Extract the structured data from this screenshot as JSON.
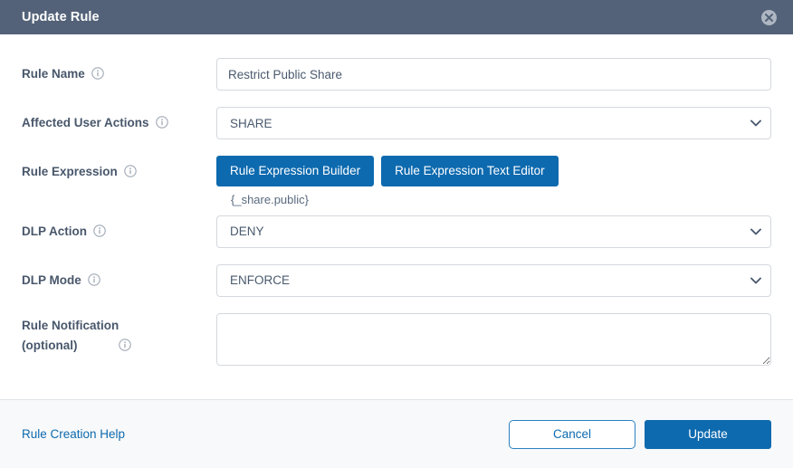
{
  "header": {
    "title": "Update Rule",
    "close_icon": "close-circle-icon"
  },
  "form": {
    "info_icon": "info-circle-icon",
    "rule_name": {
      "label": "Rule Name",
      "value": "Restrict Public Share",
      "placeholder": ""
    },
    "affected_user_actions": {
      "label": "Affected User Actions",
      "value": "SHARE",
      "chevron_icon": "chevron-down-icon"
    },
    "rule_expression": {
      "label": "Rule Expression",
      "builder_button": "Rule Expression Builder",
      "text_editor_button": "Rule Expression Text Editor",
      "expression": "{_share.public}"
    },
    "dlp_action": {
      "label": "DLP Action",
      "value": "DENY",
      "chevron_icon": "chevron-down-icon"
    },
    "dlp_mode": {
      "label": "DLP Mode",
      "value": "ENFORCE",
      "chevron_icon": "chevron-down-icon"
    },
    "rule_notification": {
      "label_line1": "Rule Notification",
      "label_line2": "(optional)",
      "value": "",
      "placeholder": ""
    }
  },
  "footer": {
    "help_link": "Rule Creation Help",
    "cancel_label": "Cancel",
    "update_label": "Update"
  },
  "colors": {
    "header_bg": "#536278",
    "primary_blue": "#0d6aaf",
    "label_text": "#48576b",
    "footer_bg": "#f8f9fa"
  }
}
